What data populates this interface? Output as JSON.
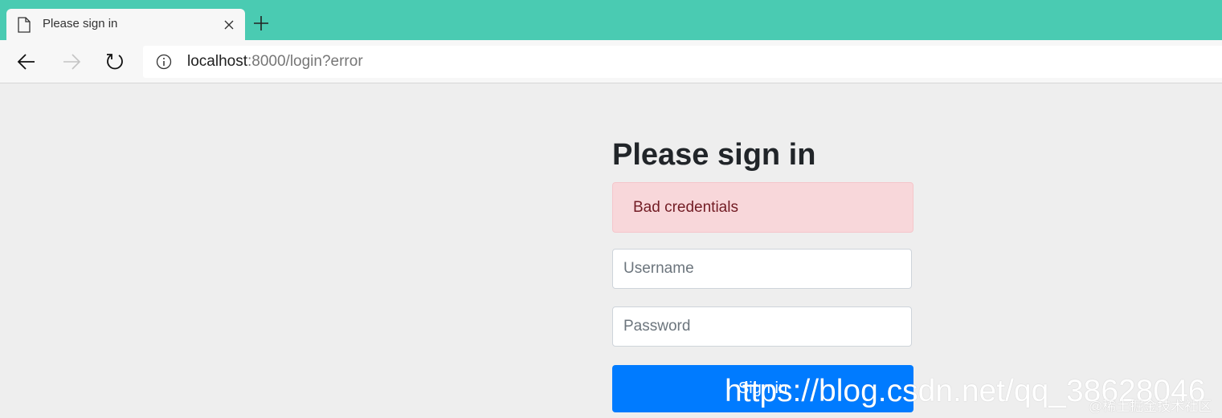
{
  "browser": {
    "tab": {
      "title": "Please sign in"
    },
    "address_bar": {
      "host": "localhost",
      "rest": ":8000/login?error"
    }
  },
  "page": {
    "heading": "Please sign in",
    "alert_text": "Bad credentials",
    "username_placeholder": "Username",
    "password_placeholder": "Password",
    "signin_label": "Sign in"
  },
  "watermark": {
    "url": "https://blog.csdn.net/qq_38628046",
    "credit": "@稀土掘金技术社区"
  },
  "colors": {
    "tabstrip": "#4acbb2",
    "primary_button": "#007bff",
    "alert_bg": "#f8d7da",
    "alert_text": "#721c24"
  },
  "icons": [
    "page-icon",
    "close-icon",
    "new-tab-icon",
    "back-icon",
    "forward-icon",
    "refresh-icon",
    "info-icon"
  ]
}
